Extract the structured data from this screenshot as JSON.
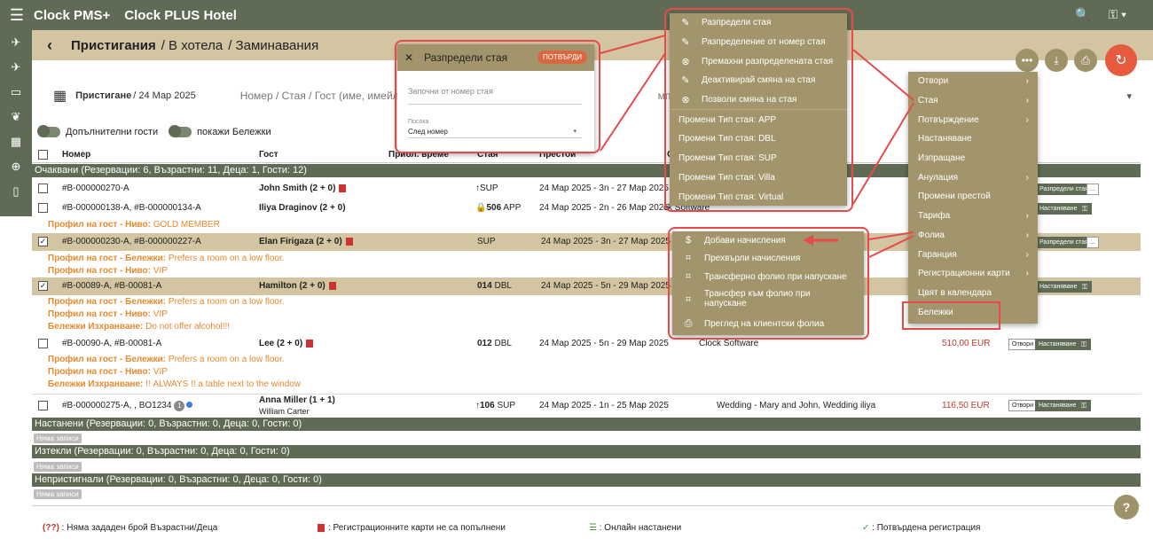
{
  "app": {
    "brand": "Clock PMS+",
    "hotel": "Clock PLUS Hotel"
  },
  "breadcrumb": {
    "arrivals": "Пристигания",
    "inhouse": "/ В хотела",
    "departures": "/ Заминавания"
  },
  "filters": {
    "arrival_label": "Пристигане",
    "arrival_date": "/ 24 Мар 2025",
    "search_placeholder": "Номер / Стая / Гост (име, имейл, теле",
    "company_placeholder": "мпания / Аген"
  },
  "toggles": {
    "additional_guests": "Допълнителни гости",
    "show_notes": "покажи Бележки"
  },
  "columns": {
    "number": "Номер",
    "guest": "Гост",
    "arrival_time": "Прибл. време",
    "room": "Стая",
    "stay": "Престой",
    "source": "С"
  },
  "sections": {
    "expected": "Очаквани (Резервации: 6, Възрастни: 11, Деца: 1, Гости: 12)",
    "checkedin": "Настанени (Резервации: 0, Възрастни: 0, Деца: 0, Гости: 0)",
    "departed": "Изтекли (Резервации: 0, Възрастни: 0, Деца: 0, Гости: 0)",
    "noshow": "Непристигнали (Резервации: 0, Възрастни: 0, Деца: 0, Гости: 0)"
  },
  "no_entries": "Няма записи",
  "rows": [
    {
      "number": "#B-000000270-A",
      "guest": "John Smith (2 + 0)",
      "room": "SUP",
      "stay": "24 Мар 2025 - 3n - 27 Мар 2025",
      "btn": "Разпредели стая"
    },
    {
      "number": "#B-000000138-A, #B-000000134-A",
      "guest": "Iliya Draginov (2 + 0)",
      "room": "506",
      "room_type": "APP",
      "stay": "24 Мар 2025 - 2n - 26 Мар 2025",
      "source": "ck Software",
      "btn": "Настаняване",
      "note1": "Профил на гост - Ниво:",
      "note1v": "GOLD MEMBER"
    },
    {
      "number": "#B-000000230-A, #B-000000227-A",
      "guest": "Elan Firigaza (2 + 0)",
      "room": "SUP",
      "stay": "24 Мар 2025 - 3n - 27 Мар 2025",
      "btn": "Разпредели стая",
      "note1": "Профил на гост - Бележки:",
      "note1v": "Prefers a room on a low floor.",
      "note2": "Профил на гост - Ниво:",
      "note2v": "VIP"
    },
    {
      "number": "#B-00089-A, #B-00081-A",
      "guest": "Hamilton (2 + 0)",
      "room": "014",
      "room_type": "DBL",
      "stay": "24 Мар 2025 - 5n - 29 Мар 2025",
      "btn": "Настаняване",
      "note1": "Профил на гост - Бележки:",
      "note1v": "Prefers a room on a low floor.",
      "note2": "Профил на гост - Ниво:",
      "note2v": "VIP",
      "note3": "Бележки Изхранване:",
      "note3v": "Do not offer alcohol!!!"
    },
    {
      "number": "#B-00090-A, #B-00081-A",
      "guest": "Lee (2 + 0)",
      "room": "012",
      "room_type": "DBL",
      "stay": "24 Мар 2025 - 5n - 29 Мар 2025",
      "source": "Clock Software",
      "price": "510,00 EUR",
      "btn0": "Отвори",
      "btn": "Настаняване",
      "note1": "Профил на гост - Бележки:",
      "note1v": "Prefers a room on a low floor.",
      "note2": "Профил на гост - Ниво:",
      "note2v": "VIP",
      "note3": "Бележки Изхранване:",
      "note3v": "!! ALWAYS !! a table next to the window"
    },
    {
      "number": "#B-000000275-A, , BO1234",
      "badge": "1",
      "guest": "Anna Miller (1 + 1)",
      "guest2": "William Carter",
      "room": "106",
      "room_type": "SUP",
      "stay": "24 Мар 2025 - 1n - 25 Мар 2025",
      "source": "Wedding - Mary and John, Wedding iliya",
      "price": "116,50 EUR",
      "btn0": "Отвори",
      "btn": "Настаняване"
    }
  ],
  "dialog": {
    "title": "Разпредели стая",
    "confirm": "ПОТВЪРДИ",
    "start_from": "Започни от номер стая",
    "direction_label": "Посока",
    "direction_value": "След номер"
  },
  "room_menu": [
    {
      "icon": "✎",
      "label": "Разпредели стая"
    },
    {
      "icon": "✎",
      "label": "Разпределение от номер стая"
    },
    {
      "icon": "⊗",
      "label": "Премахни разпределената стая"
    },
    {
      "icon": "✎",
      "label": "Деактивирай смяна на стая"
    },
    {
      "icon": "⊗",
      "label": "Позволи смяна на стая"
    },
    {
      "label": "Промени Тип стая: APP"
    },
    {
      "label": "Промени Тип стая: DBL"
    },
    {
      "label": "Промени Тип стая: SUP"
    },
    {
      "label": "Промени Тип стая: Villa"
    },
    {
      "label": "Промени Тип стая: Virtual"
    }
  ],
  "folio_menu": [
    {
      "icon": "$",
      "label": "Добави начисления"
    },
    {
      "icon": "⌗",
      "label": "Прехвърли начисления"
    },
    {
      "icon": "⌗",
      "label": "Трансферно фолио при напускане"
    },
    {
      "icon": "⌗",
      "label": "Трансфер към фолио при",
      "label2": "напускане"
    },
    {
      "icon": "⎙",
      "label": "Преглед на клиентски фолиа"
    }
  ],
  "main_menu": [
    {
      "label": "Отвори",
      "sub": true
    },
    {
      "label": "Стая",
      "sub": true
    },
    {
      "label": "Потвърждение",
      "sub": true
    },
    {
      "label": "Настаняване"
    },
    {
      "label": "Изпращане"
    },
    {
      "label": "Анулация",
      "sub": true
    },
    {
      "label": "Промени престой"
    },
    {
      "label": "Тарифа",
      "sub": true
    },
    {
      "label": "Фолиа",
      "sub": true
    },
    {
      "label": "Гаранция",
      "sub": true
    },
    {
      "label": "Регистрационни карти",
      "sub": true
    },
    {
      "label": "Цвят в календара"
    },
    {
      "label": "Бележки"
    }
  ],
  "legend": {
    "no_count": "(??)",
    "no_count_text": ": Няма зададен брой Възрастни/Деца",
    "reg_cards": ": Регистрационните карти не са попълнени",
    "online": ": Онлайн настанени",
    "confirmed": ": Потвърдена регистрация"
  },
  "colors": {
    "primary": "#5f6b54",
    "menu": "#a3956b",
    "header": "#d3c5a1",
    "accent": "#e65a3e",
    "highlight": "#e84a4a",
    "note": "#e68a2e"
  }
}
